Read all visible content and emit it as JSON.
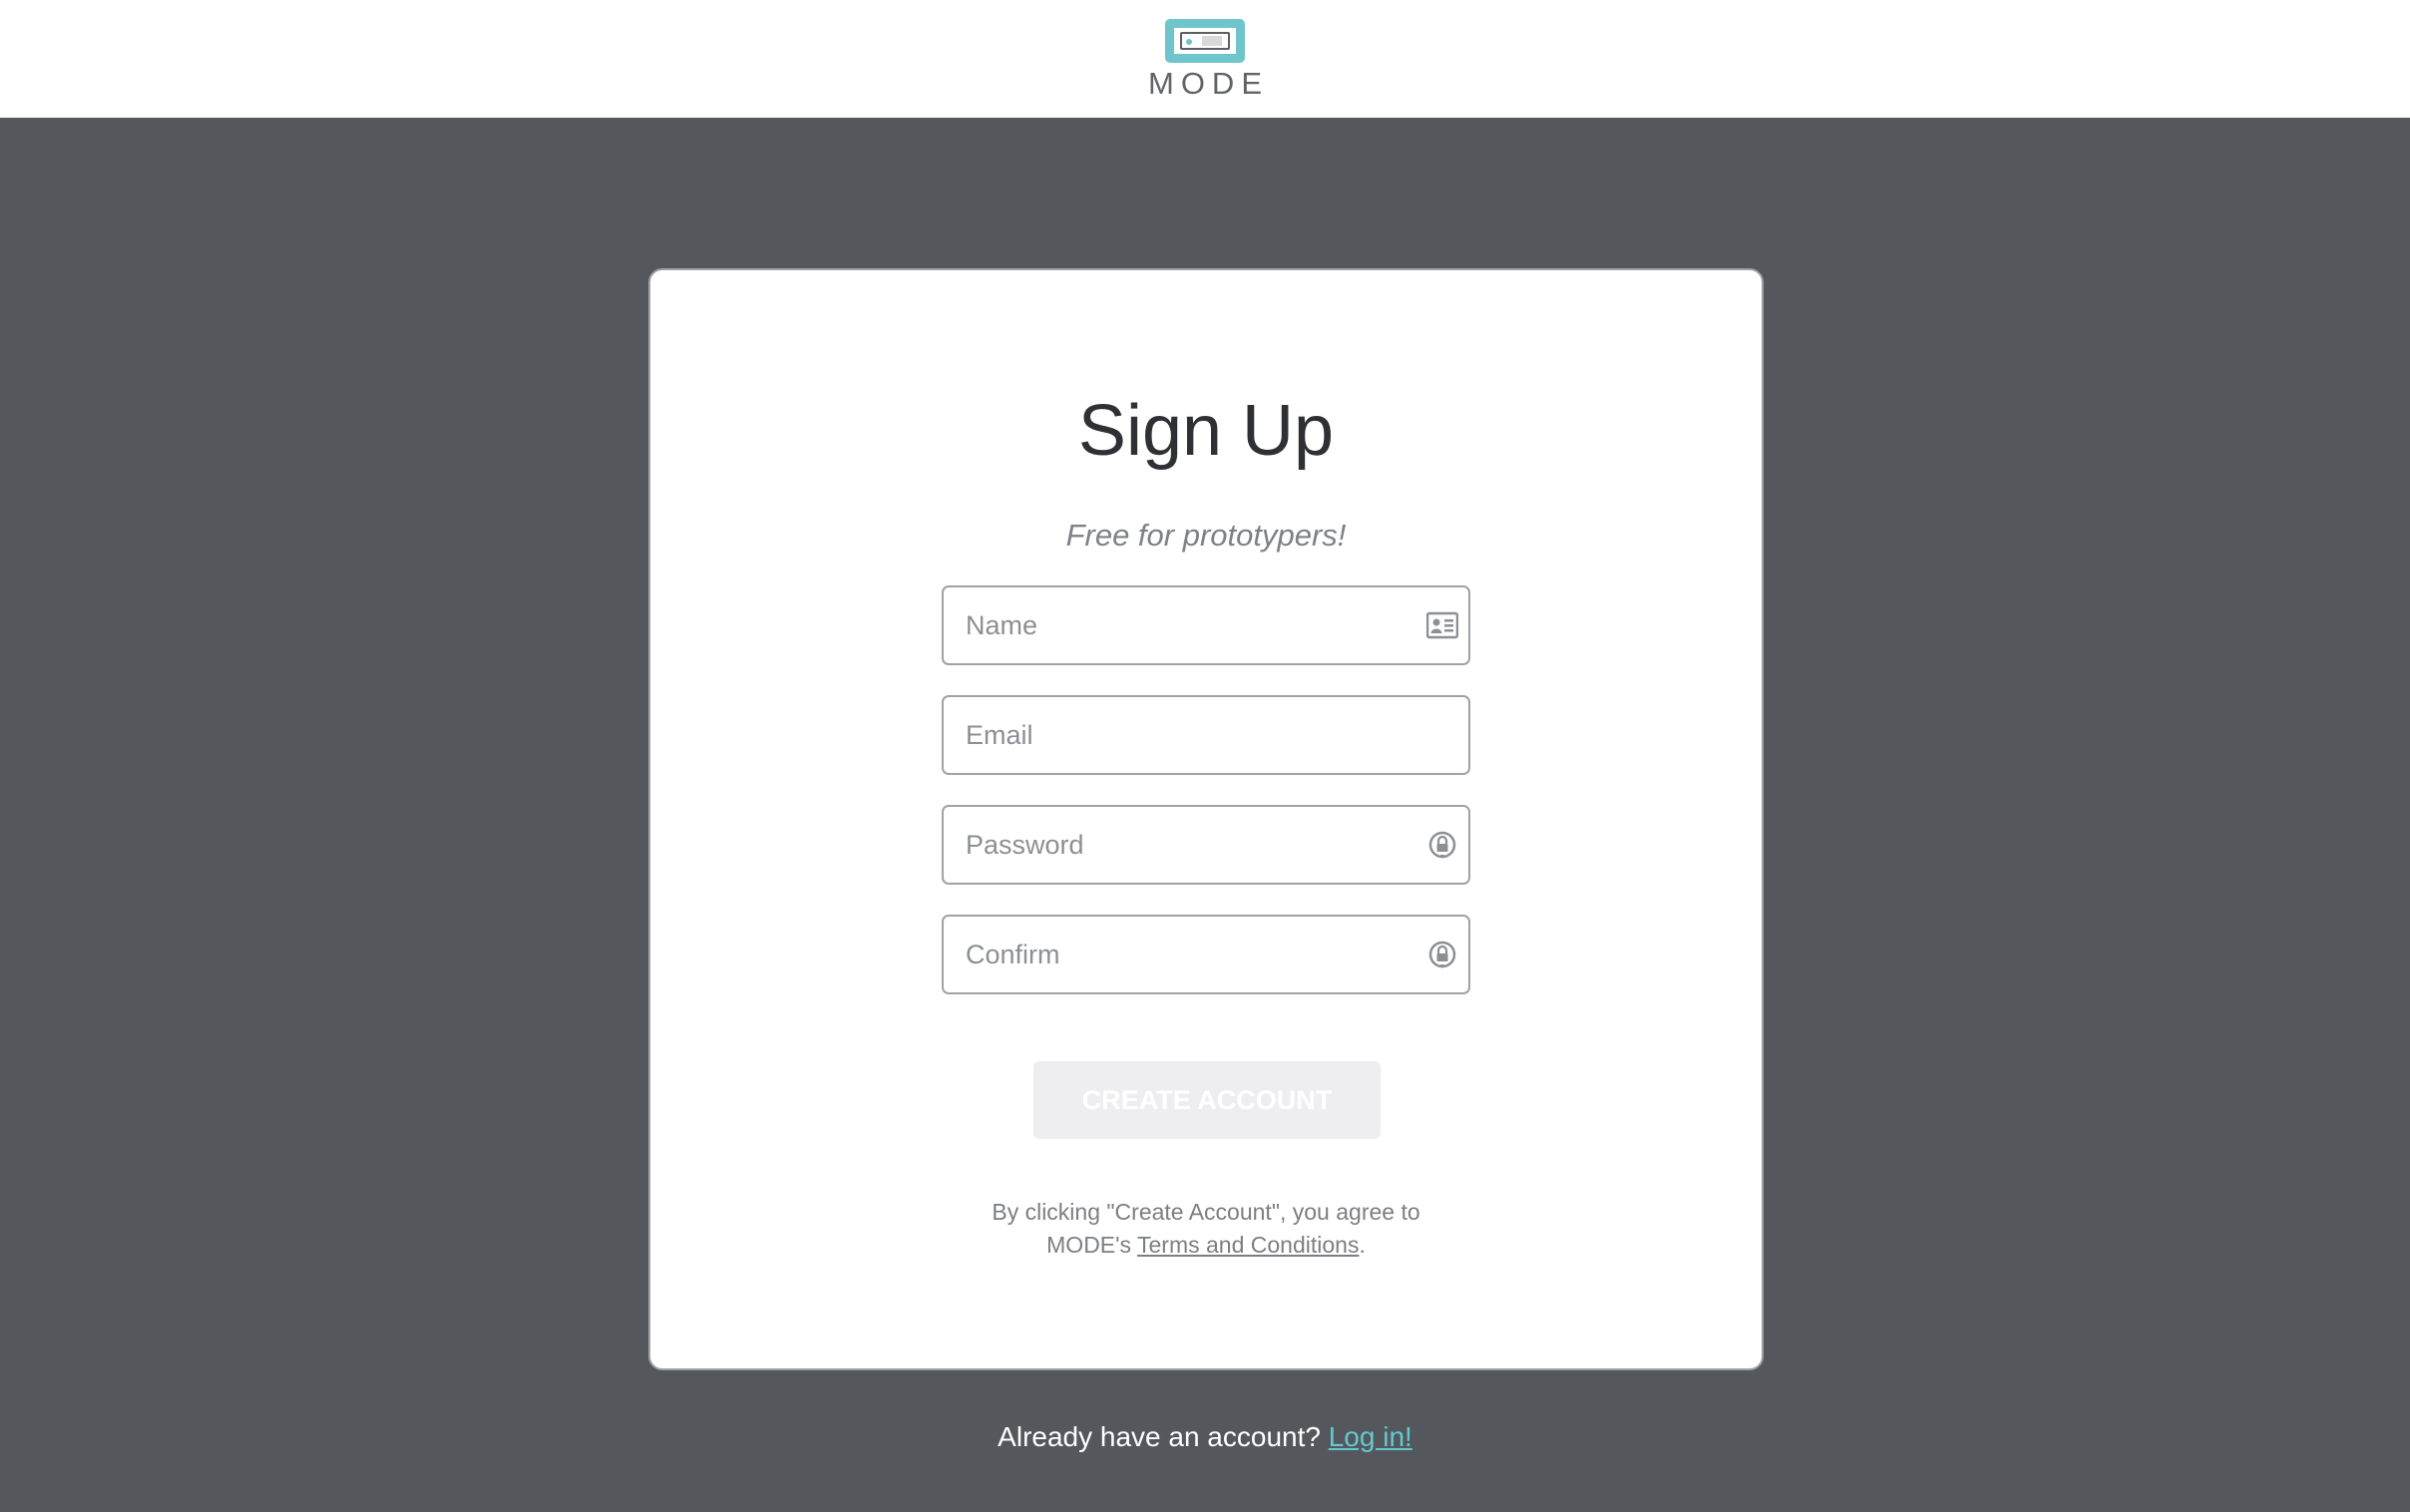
{
  "brand": {
    "name": "MODE",
    "accent_color": "#6ec6cc"
  },
  "form": {
    "title": "Sign Up",
    "subtitle": "Free for prototypers!",
    "fields": {
      "name": {
        "placeholder": "Name",
        "icon": "contact-card-icon"
      },
      "email": {
        "placeholder": "Email"
      },
      "password": {
        "placeholder": "Password",
        "icon": "lock-icon"
      },
      "confirm": {
        "placeholder": "Confirm",
        "icon": "lock-icon"
      }
    },
    "submit_label": "CREATE ACCOUNT",
    "terms_prefix": "By clicking \"Create Account\", you agree to",
    "terms_owner": "MODE's ",
    "terms_link": "Terms and Conditions",
    "terms_suffix": "."
  },
  "footer": {
    "prompt": "Already have an account? ",
    "login_link": "Log in!"
  }
}
